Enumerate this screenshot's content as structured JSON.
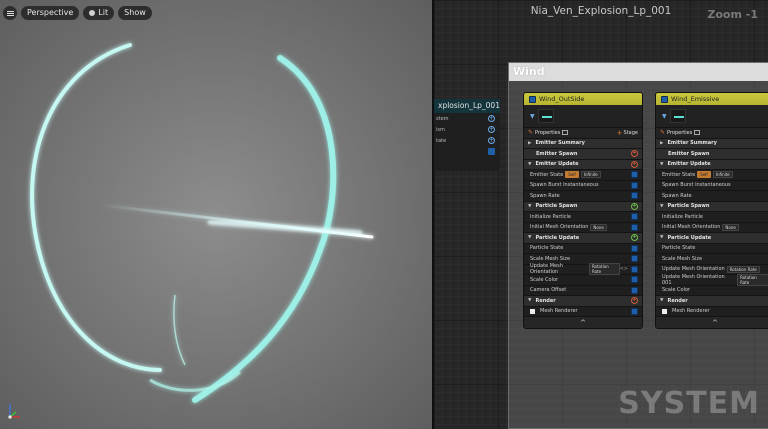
{
  "viewport": {
    "view_mode": "Perspective",
    "lighting": "Lit",
    "show": "Show"
  },
  "graph": {
    "title": "Nia_Ven_Explosion_Lp_001",
    "zoom": "Zoom -1",
    "watermark": "SYSTEM",
    "left_node": {
      "title": "xplosion_Lp_001",
      "rows": [
        "stem",
        "ism",
        "tate"
      ]
    },
    "system_box": {
      "title": "Wind"
    },
    "emitters": [
      {
        "name": "Wind_OutSide",
        "properties": "Properties",
        "stage": "Stage",
        "emitter_summary": "Emitter Summary",
        "emitter_spawn": "Emitter Spawn",
        "emitter_update": "Emitter Update",
        "emitter_state": "Emitter State",
        "self": "Self",
        "infinite": "Infinite",
        "spawn_burst": "Spawn Burst Instantaneous",
        "spawn_rate": "Spawn Rate",
        "particle_spawn": "Particle Spawn",
        "initialize_particle": "Initialize Particle",
        "initial_mesh_orientation": "Initial Mesh Orientation",
        "none": "None",
        "particle_update": "Particle Update",
        "update_items": [
          {
            "label": "Particle State"
          },
          {
            "label": "Scale Mesh Size"
          },
          {
            "label": "Update Mesh Orientation",
            "chip": "Rotation Rate"
          },
          {
            "label": "Scale Color"
          },
          {
            "label": "Camera Offset"
          }
        ],
        "render": "Render",
        "mesh_renderer": "Mesh Renderer",
        "footer": "^"
      },
      {
        "name": "Wind_Emissive",
        "properties": "Properties",
        "stage": "",
        "emitter_summary": "Emitter Summary",
        "emitter_spawn": "Emitter Spawn",
        "emitter_update": "Emitter Update",
        "emitter_state": "Emitter State",
        "self": "Self",
        "infinite": "Infinite",
        "spawn_burst": "Spawn Burst Instantaneous",
        "spawn_rate": "Spawn Rate",
        "particle_spawn": "Particle Spawn",
        "initialize_particle": "Initialize Particle",
        "initial_mesh_orientation": "Initial Mesh Orientation",
        "none": "None",
        "particle_update": "Particle Update",
        "update_items": [
          {
            "label": "Particle State"
          },
          {
            "label": "Scale Mesh Size"
          },
          {
            "label": "Update Mesh Orientation",
            "chip": "Rotation Rate"
          },
          {
            "label": "Update Mesh Orientation 001",
            "chip": "Rotation Rate"
          },
          {
            "label": "Scale Color"
          }
        ],
        "render": "Render",
        "mesh_renderer": "Mesh Renderer",
        "footer": "^"
      }
    ]
  },
  "colors": {
    "emitter_header": "#c4c238",
    "fx_glow": "#bff6f0",
    "checkbox": "#1f5fa8"
  }
}
